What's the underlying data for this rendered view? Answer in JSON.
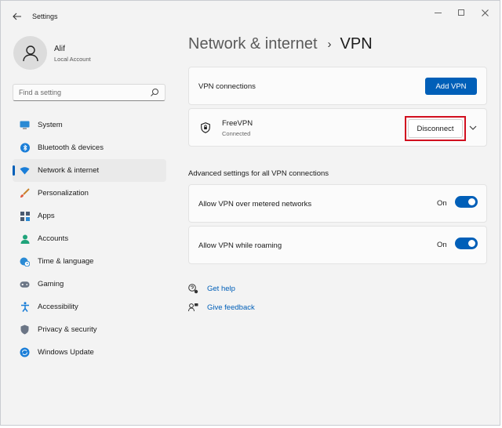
{
  "window": {
    "title": "Settings",
    "controls": [
      "minimize-icon",
      "maximize-icon",
      "close-icon"
    ]
  },
  "profile": {
    "name": "Alif",
    "account_type": "Local Account"
  },
  "search": {
    "placeholder": "Find a setting"
  },
  "sidebar": {
    "items": [
      {
        "label": "System",
        "icon": "monitor-icon",
        "active": false
      },
      {
        "label": "Bluetooth & devices",
        "icon": "bluetooth-icon",
        "active": false
      },
      {
        "label": "Network & internet",
        "icon": "wifi-icon",
        "active": true
      },
      {
        "label": "Personalization",
        "icon": "brush-icon",
        "active": false
      },
      {
        "label": "Apps",
        "icon": "apps-icon",
        "active": false
      },
      {
        "label": "Accounts",
        "icon": "person-icon",
        "active": false
      },
      {
        "label": "Time & language",
        "icon": "globe-clock-icon",
        "active": false
      },
      {
        "label": "Gaming",
        "icon": "gamepad-icon",
        "active": false
      },
      {
        "label": "Accessibility",
        "icon": "accessibility-icon",
        "active": false
      },
      {
        "label": "Privacy & security",
        "icon": "shield-icon",
        "active": false
      },
      {
        "label": "Windows Update",
        "icon": "update-icon",
        "active": false
      }
    ]
  },
  "header": {
    "parent": "Network & internet",
    "separator": "›",
    "current": "VPN"
  },
  "vpn_connections": {
    "label": "VPN connections",
    "add_button": "Add VPN"
  },
  "connection": {
    "name": "FreeVPN",
    "status": "Connected",
    "disconnect_button": "Disconnect"
  },
  "advanced": {
    "title": "Advanced settings for all VPN connections",
    "settings": [
      {
        "label": "Allow VPN over metered networks",
        "state": "On"
      },
      {
        "label": "Allow VPN while roaming",
        "state": "On"
      }
    ]
  },
  "links": {
    "help": "Get help",
    "feedback": "Give feedback"
  },
  "colors": {
    "accent": "#005fb8",
    "highlight": "#d10f1f",
    "background": "#f3f3f3"
  }
}
